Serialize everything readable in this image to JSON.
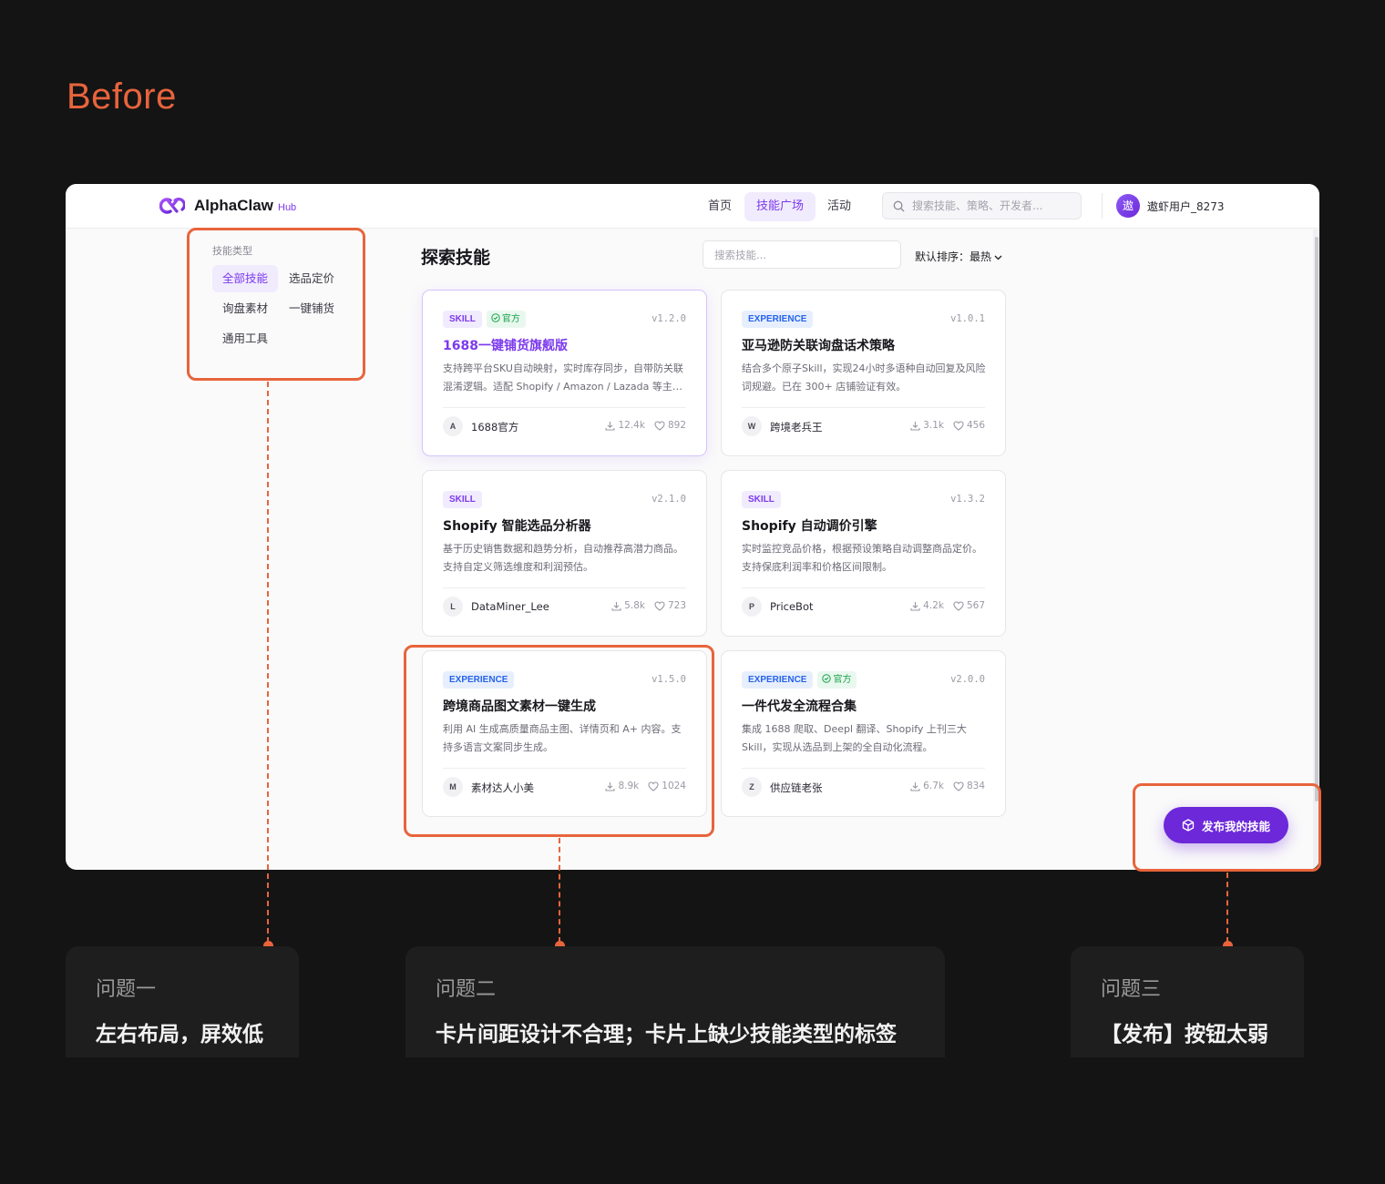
{
  "heading": "Before",
  "app": {
    "logo": {
      "name": "AlphaClaw",
      "suffix": "Hub"
    },
    "nav": [
      "首页",
      "技能广场",
      "活动"
    ],
    "nav_active_index": 1,
    "search_placeholder": "搜索技能、策略、开发者...",
    "user": {
      "avatar_text": "遨",
      "name": "遨虾用户_8273"
    },
    "sidebar": {
      "heading": "技能类型",
      "items": [
        "全部技能",
        "选品定价",
        "询盘素材",
        "一键铺货",
        "通用工具"
      ],
      "active_index": 0
    },
    "main": {
      "title": "探索技能",
      "search_placeholder": "搜索技能...",
      "sort_label": "默认排序：最热"
    },
    "cards": [
      {
        "tag": "SKILL",
        "official": "官方",
        "version": "v1.2.0",
        "title": "1688一键铺货旗舰版",
        "desc": "支持跨平台SKU自动映射，实时库存同步，自带防关联混淆逻辑。适配 Shopify / Amazon / Lazada 等主流平台。",
        "author_initial": "A",
        "author": "1688官方",
        "downloads": "12.4k",
        "likes": "892"
      },
      {
        "tag": "EXPERIENCE",
        "official": "",
        "version": "v1.0.1",
        "title": "亚马逊防关联询盘话术策略",
        "desc": "结合多个原子Skill，实现24小时多语种自动回复及风险词规避。已在 300+ 店铺验证有效。",
        "author_initial": "W",
        "author": "跨境老兵王",
        "downloads": "3.1k",
        "likes": "456"
      },
      {
        "tag": "SKILL",
        "official": "",
        "version": "v2.1.0",
        "title": "Shopify 智能选品分析器",
        "desc": "基于历史销售数据和趋势分析，自动推荐高潜力商品。支持自定义筛选维度和利润预估。",
        "author_initial": "L",
        "author": "DataMiner_Lee",
        "downloads": "5.8k",
        "likes": "723"
      },
      {
        "tag": "SKILL",
        "official": "",
        "version": "v1.3.2",
        "title": "Shopify 自动调价引擎",
        "desc": "实时监控竞品价格，根据预设策略自动调整商品定价。支持保底利润率和价格区间限制。",
        "author_initial": "P",
        "author": "PriceBot",
        "downloads": "4.2k",
        "likes": "567"
      },
      {
        "tag": "EXPERIENCE",
        "official": "",
        "version": "v1.5.0",
        "title": "跨境商品图文素材一键生成",
        "desc": "利用 AI 生成高质量商品主图、详情页和 A+ 内容。支持多语言文案同步生成。",
        "author_initial": "M",
        "author": "素材达人小美",
        "downloads": "8.9k",
        "likes": "1024"
      },
      {
        "tag": "EXPERIENCE",
        "official": "官方",
        "version": "v2.0.0",
        "title": "一件代发全流程合集",
        "desc": "集成 1688 爬取、Deepl 翻译、Shopify 上刊三大Skill，实现从选品到上架的全自动化流程。",
        "author_initial": "Z",
        "author": "供应链老张",
        "downloads": "6.7k",
        "likes": "834"
      }
    ],
    "publish_button": "发布我的技能"
  },
  "issues": [
    {
      "label": "问题一",
      "text": "左右布局，屏效低"
    },
    {
      "label": "问题二",
      "text": "卡片间距设计不合理；卡片上缺少技能类型的标签"
    },
    {
      "label": "问题三",
      "text": "【发布】按钮太弱"
    }
  ],
  "colors": {
    "accent": "#e8643c",
    "brand": "#7c3aed",
    "background": "#141414"
  }
}
